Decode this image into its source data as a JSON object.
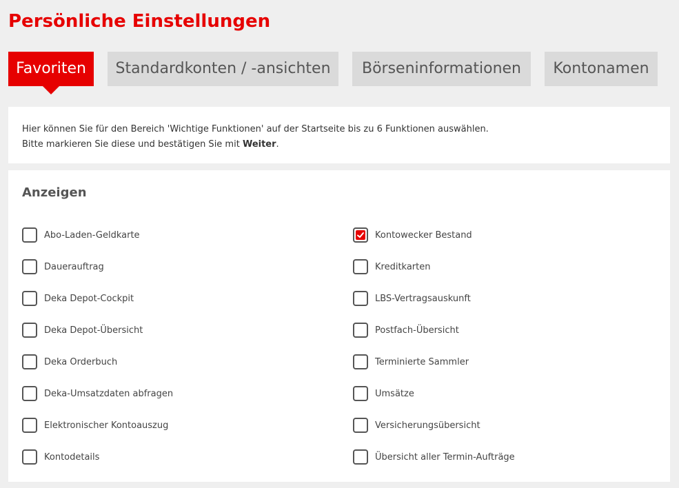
{
  "page": {
    "title": "Persönliche Einstellungen"
  },
  "tabs": [
    {
      "label": "Favoriten",
      "active": true
    },
    {
      "label": "Standardkonten / -ansichten",
      "active": false
    },
    {
      "label": "Börseninformationen",
      "active": false
    },
    {
      "label": "Kontonamen",
      "active": false
    }
  ],
  "info": {
    "line1": "Hier können Sie für den Bereich 'Wichtige Funktionen' auf der Startseite bis zu 6 Funktionen auswählen.",
    "line2_prefix": "Bitte markieren Sie diese und bestätigen Sie mit ",
    "line2_bold": "Weiter",
    "line2_suffix": "."
  },
  "section": {
    "title": "Anzeigen"
  },
  "options_left": [
    {
      "label": "Abo-Laden-Geldkarte",
      "checked": false
    },
    {
      "label": "Dauerauftrag",
      "checked": false
    },
    {
      "label": "Deka Depot-Cockpit",
      "checked": false
    },
    {
      "label": "Deka Depot-Übersicht",
      "checked": false
    },
    {
      "label": "Deka Orderbuch",
      "checked": false
    },
    {
      "label": "Deka-Umsatzdaten abfragen",
      "checked": false
    },
    {
      "label": "Elektronischer Kontoauszug",
      "checked": false
    },
    {
      "label": "Kontodetails",
      "checked": false
    }
  ],
  "options_right": [
    {
      "label": "Kontowecker Bestand",
      "checked": true
    },
    {
      "label": "Kreditkarten",
      "checked": false
    },
    {
      "label": "LBS-Vertragsauskunft",
      "checked": false
    },
    {
      "label": "Postfach-Übersicht",
      "checked": false
    },
    {
      "label": "Terminierte Sammler",
      "checked": false
    },
    {
      "label": "Umsätze",
      "checked": false
    },
    {
      "label": "Versicherungsübersicht",
      "checked": false
    },
    {
      "label": "Übersicht aller Termin-Aufträge",
      "checked": false
    }
  ],
  "colors": {
    "accent": "#e60000",
    "tab_inactive_bg": "#dadada",
    "page_bg": "#efefef"
  }
}
